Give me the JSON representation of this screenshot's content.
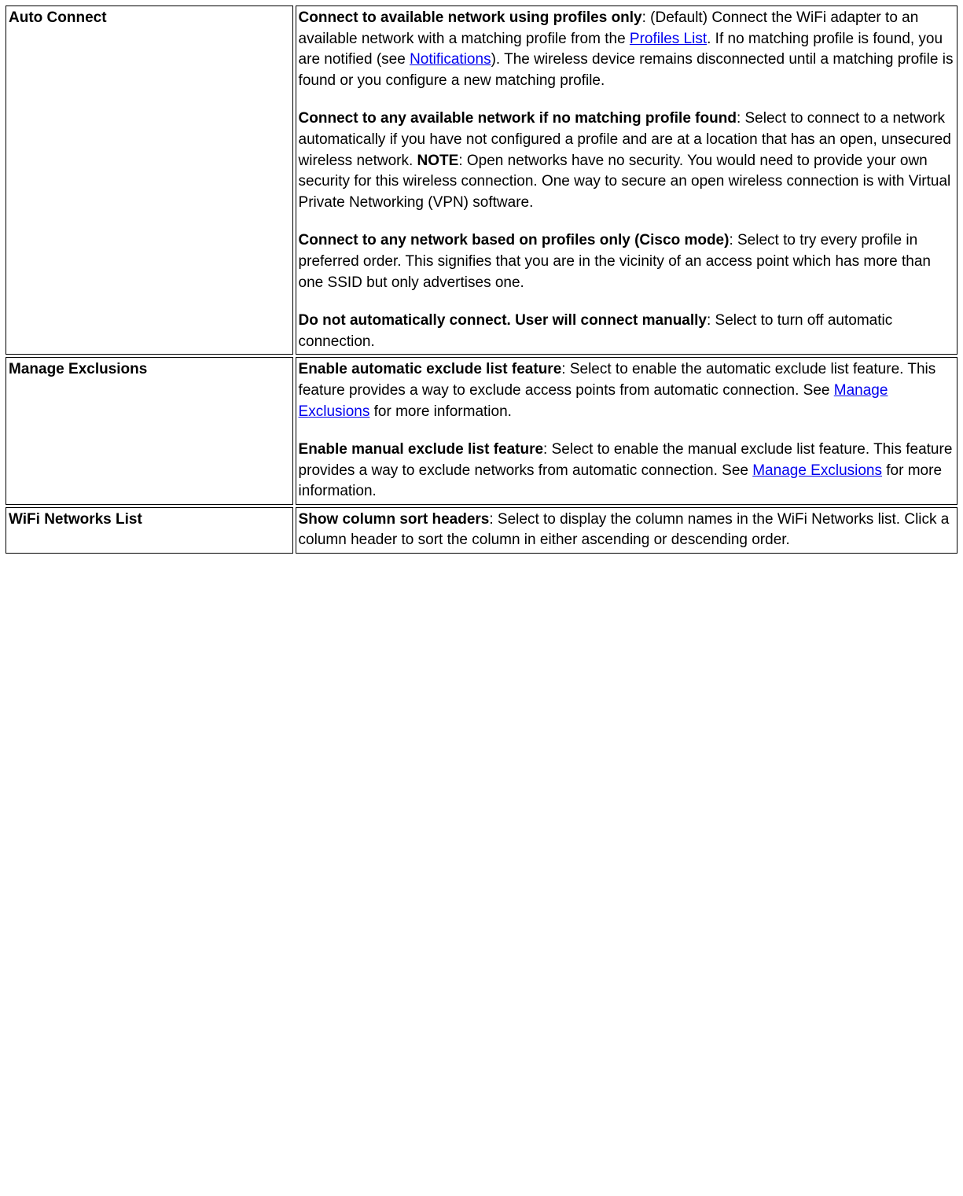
{
  "rows": [
    {
      "label": "Auto Connect",
      "paras": [
        {
          "runs": [
            {
              "bold": true,
              "text": "Connect to available network using profiles only"
            },
            {
              "text": ": (Default) Connect the WiFi adapter to an available network with a matching profile from the "
            },
            {
              "link": true,
              "text": "Profiles List"
            },
            {
              "text": ". If no matching profile is found, you are notified (see "
            },
            {
              "link": true,
              "text": "Notifications"
            },
            {
              "text": "). The wireless device remains disconnected until a matching profile is found or you configure a new matching profile."
            }
          ]
        },
        {
          "runs": [
            {
              "bold": true,
              "text": "Connect to any available network if no matching profile found"
            },
            {
              "text": ": Select to connect to a network automatically if you have not configured a profile and are at a location that has an open, unsecured wireless network. "
            },
            {
              "bold": true,
              "text": "NOTE"
            },
            {
              "text": ": Open networks have no security. You would need to provide your own security for this wireless connection. One way to secure an open wireless connection is with Virtual Private Networking (VPN) software."
            }
          ]
        },
        {
          "runs": [
            {
              "bold": true,
              "text": "Connect to any network based on profiles only (Cisco mode)"
            },
            {
              "text": ": Select to try every profile in preferred order. This signifies that you are in the vicinity of an access point which has more than one SSID but only advertises one."
            }
          ]
        },
        {
          "runs": [
            {
              "bold": true,
              "text": "Do not automatically connect. User will connect manually"
            },
            {
              "text": ": Select to turn off automatic connection."
            }
          ]
        }
      ]
    },
    {
      "label": "Manage Exclusions",
      "paras": [
        {
          "runs": [
            {
              "bold": true,
              "text": "Enable automatic exclude list feature"
            },
            {
              "text": ": Select to enable the automatic exclude list feature. This feature provides a way to exclude access points from automatic connection. See "
            },
            {
              "link": true,
              "text": "Manage Exclusions"
            },
            {
              "text": " for more information."
            }
          ]
        },
        {
          "runs": [
            {
              "bold": true,
              "text": "Enable manual exclude list feature"
            },
            {
              "text": ": Select to enable the manual exclude list feature. This feature provides a way to exclude networks from automatic connection. See "
            },
            {
              "link": true,
              "text": "Manage Exclusions"
            },
            {
              "text": " for more information."
            }
          ]
        }
      ]
    },
    {
      "label": "WiFi Networks List",
      "paras": [
        {
          "runs": [
            {
              "bold": true,
              "text": "Show column sort headers"
            },
            {
              "text": ": Select to display the column names in the WiFi Networks list. Click a column header to sort the column in either ascending or descending order."
            }
          ]
        }
      ]
    }
  ]
}
